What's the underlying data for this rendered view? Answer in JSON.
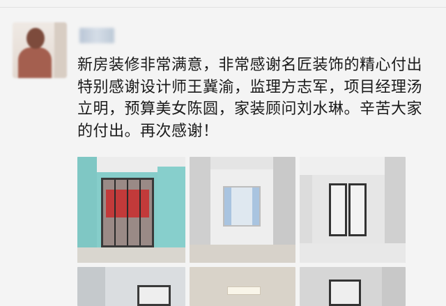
{
  "post": {
    "username": "Lo",
    "text": "新房装修非常满意，非常感谢名匠装饰的精心付出特别感谢设计师王冀渝，监理方志军，项目经理汤立明，预算美女陈圆，家装顾问刘水琳。辛苦大家的付出。再次感谢！",
    "photos": [
      {
        "name": "room-photo-1"
      },
      {
        "name": "room-photo-2"
      },
      {
        "name": "room-photo-3"
      },
      {
        "name": "room-photo-4"
      },
      {
        "name": "room-photo-5"
      },
      {
        "name": "room-photo-6"
      }
    ]
  }
}
